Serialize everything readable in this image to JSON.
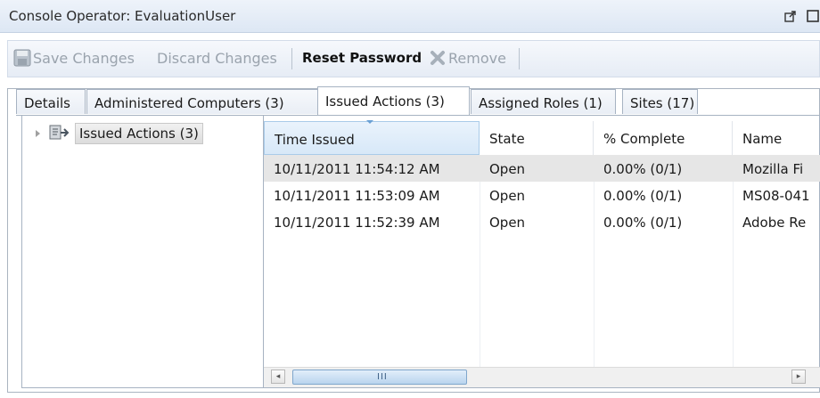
{
  "window": {
    "title": "Console Operator: EvaluationUser"
  },
  "toolbar": {
    "save_label": "Save Changes",
    "discard_label": "Discard Changes",
    "reset_label": "Reset Password",
    "remove_label": "Remove"
  },
  "tabs": [
    {
      "label": "Details"
    },
    {
      "label": "Administered Computers (3)"
    },
    {
      "label": "Issued Actions (3)",
      "active": true
    },
    {
      "label": "Assigned Roles (1)"
    },
    {
      "label": "Sites (17)"
    }
  ],
  "tree": {
    "root_label": "Issued Actions (3)"
  },
  "grid": {
    "columns": [
      "Time Issued",
      "State",
      "% Complete",
      "Name"
    ],
    "sorted_column": "Time Issued",
    "rows": [
      [
        "10/11/2011 11:54:12 AM",
        "Open",
        "0.00% (0/1)",
        "Mozilla Fi"
      ],
      [
        "10/11/2011 11:53:09 AM",
        "Open",
        "0.00% (0/1)",
        "MS08-041"
      ],
      [
        "10/11/2011 11:52:39 AM",
        "Open",
        "0.00% (0/1)",
        "Adobe Re"
      ]
    ],
    "selected_row": 0
  },
  "scrollbar": {
    "grip": "III"
  },
  "colors": {
    "accent": "#d7e8f8",
    "selection": "#e6e6e6",
    "border": "#a7b3c2"
  }
}
